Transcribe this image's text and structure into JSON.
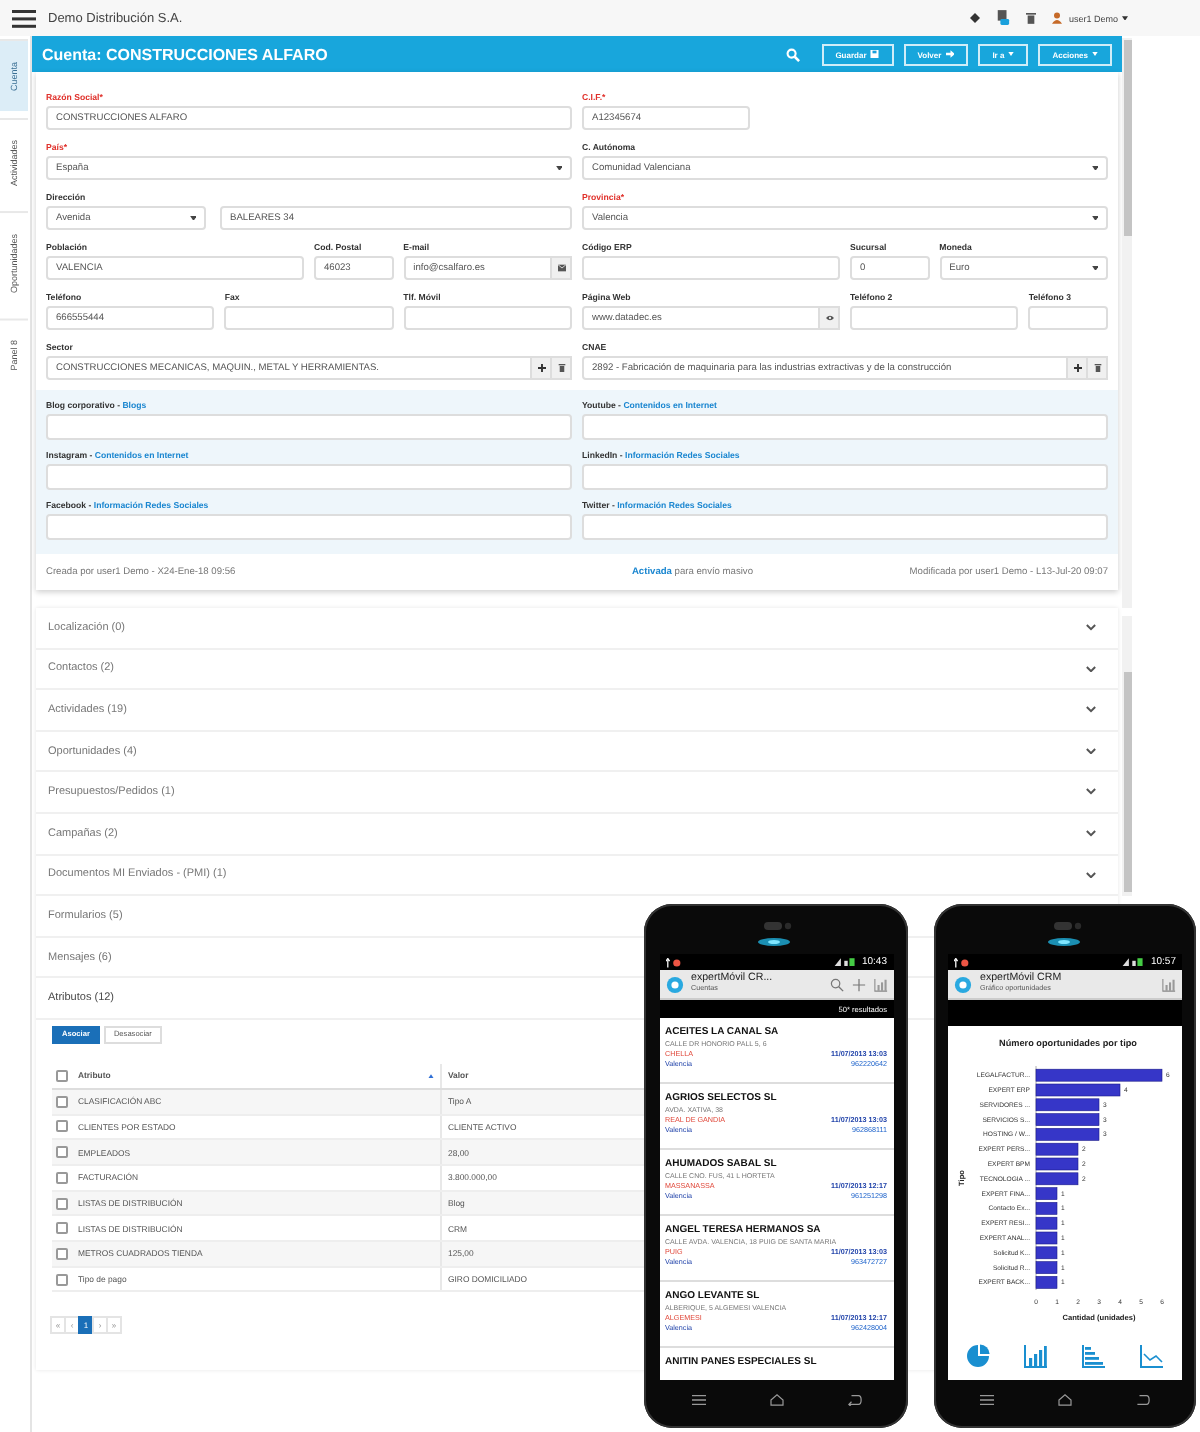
{
  "topbar": {
    "company": "Demo Distribución S.A.",
    "user": "user1 Demo"
  },
  "side_tabs": [
    {
      "label": "Cuenta",
      "selected": true
    },
    {
      "label": "Actividades",
      "selected": false
    },
    {
      "label": "Oportunidades",
      "selected": false
    },
    {
      "label": "Panel 8",
      "selected": false
    }
  ],
  "header": {
    "title": "Cuenta: CONSTRUCCIONES ALFARO",
    "buttons": [
      {
        "label": "Guardar",
        "kind": "save"
      },
      {
        "label": "Volver",
        "kind": "back"
      },
      {
        "label": "Ir a",
        "kind": "menu"
      },
      {
        "label": "Acciones",
        "kind": "menu"
      }
    ]
  },
  "form": {
    "rows": [
      [
        {
          "label": "Razón Social*",
          "required": true,
          "kind": "text",
          "value": "CONSTRUCCIONES ALFARO"
        },
        {
          "label": "C.I.F.*",
          "required": true,
          "kind": "text",
          "value": "A12345674"
        }
      ],
      [
        {
          "label": "País*",
          "required": true,
          "kind": "select",
          "value": "España"
        },
        {
          "label": "C. Autónoma",
          "required": false,
          "kind": "select",
          "value": "Comunidad Valenciana"
        }
      ],
      [
        {
          "label": "Dirección",
          "required": false,
          "kind": "address",
          "values": [
            "Avenida",
            "BALEARES 34"
          ]
        },
        {
          "label": "Provincia*",
          "required": true,
          "kind": "select",
          "value": "Valencia"
        }
      ],
      [
        {
          "label": "Población",
          "required": false,
          "kind": "text",
          "value": "VALENCIA"
        },
        {
          "label": "Cod. Postal",
          "required": false,
          "kind": "text",
          "value": "46023"
        },
        {
          "label": "E-mail",
          "required": false,
          "kind": "email",
          "value": "info@csalfaro.es"
        },
        {
          "label": "Código ERP",
          "required": false,
          "kind": "text"
        },
        {
          "label": "Sucursal",
          "required": false,
          "kind": "text",
          "value": "0"
        },
        {
          "label": "Moneda",
          "required": false,
          "kind": "select",
          "value": "Euro"
        }
      ],
      [
        {
          "label": "Teléfono",
          "required": false,
          "kind": "text",
          "value": "666555444"
        },
        {
          "label": "Fax",
          "required": false,
          "kind": "text"
        },
        {
          "label": "Tlf. Móvil",
          "required": false,
          "kind": "text"
        },
        {
          "label": "Página Web",
          "required": false,
          "kind": "web",
          "value": "www.datadec.es"
        },
        {
          "label": "Teléfono 2",
          "required": false,
          "kind": "text"
        },
        {
          "label": "Teléfono 3",
          "required": false,
          "kind": "text"
        }
      ],
      [
        {
          "label": "Sector",
          "required": false,
          "kind": "lookup",
          "value": "CONSTRUCCIONES MECANICAS, MAQUIN., METAL Y HERRAMIENTAS."
        },
        {
          "label": "CNAE",
          "required": false,
          "kind": "lookup",
          "value": "2892 - Fabricación de maquinaria para las industrias extractivas y de la construcción"
        }
      ]
    ]
  },
  "social": [
    {
      "label": "Blog corporativo -",
      "link": "Blogs"
    },
    {
      "label": "Youtube -",
      "link": "Contenidos en Internet"
    },
    {
      "label": "Instagram -",
      "link": "Contenidos en Internet"
    },
    {
      "label": "LinkedIn -",
      "link": "Información Redes Sociales"
    },
    {
      "label": "Facebook -",
      "link": "Información Redes Sociales"
    },
    {
      "label": "Twitter -",
      "link": "Información Redes Sociales"
    }
  ],
  "footer": {
    "created": "Creada por user1 Demo - X24-Ene-18 09:56",
    "mailing_link": "Activada",
    "mailing_text": "para envío masivo",
    "modified": "Modificada por user1 Demo - L13-Jul-20 09:07"
  },
  "sections": [
    {
      "label": "Localización (0)",
      "expanded": false,
      "toggle_visible": true
    },
    {
      "label": "Contactos (2)",
      "expanded": false,
      "toggle_visible": true
    },
    {
      "label": "Actividades (19)",
      "expanded": false,
      "toggle_visible": true
    },
    {
      "label": "Oportunidades (4)",
      "expanded": false,
      "toggle_visible": true
    },
    {
      "label": "Presupuestos/Pedidos (1)",
      "expanded": false,
      "toggle_visible": true
    },
    {
      "label": "Campañas (2)",
      "expanded": false,
      "toggle_visible": true
    },
    {
      "label": "Documentos MI Enviados - (PMI) (1)",
      "expanded": false,
      "toggle_visible": true
    },
    {
      "label": "Formularios (5)",
      "expanded": false,
      "toggle_visible": false
    },
    {
      "label": "Mensajes (6)",
      "expanded": false,
      "toggle_visible": false
    },
    {
      "label": "Atributos (12)",
      "expanded": true,
      "toggle_visible": false
    }
  ],
  "attributes": {
    "buttons": [
      {
        "label": "Asociar",
        "kind": "primary"
      },
      {
        "label": "Desasociar",
        "kind": "default"
      }
    ],
    "all_checked": false,
    "columns": [
      {
        "label": "Atributo",
        "sorted": true
      },
      {
        "label": "Valor",
        "sorted": false
      }
    ],
    "rows": [
      {
        "attribute": "CLASIFICACIÓN ABC",
        "value": "Tipo A",
        "checked": false
      },
      {
        "attribute": "CLIENTES POR ESTADO",
        "value": "CLIENTE ACTIVO",
        "checked": false
      },
      {
        "attribute": "EMPLEADOS",
        "value": "28,00",
        "checked": false
      },
      {
        "attribute": "FACTURACIÓN",
        "value": "3.800.000,00",
        "checked": false
      },
      {
        "attribute": "LISTAS DE DISTRIBUCIÓN",
        "value": "Blog",
        "checked": false
      },
      {
        "attribute": "LISTAS DE DISTRIBUCIÓN",
        "value": "CRM",
        "checked": false
      },
      {
        "attribute": "METROS CUADRADOS TIENDA",
        "value": "125,00",
        "checked": false
      },
      {
        "attribute": "Tipo de pago",
        "value": "GIRO DOMICILIADO",
        "checked": false
      }
    ],
    "pages": [
      {
        "label": "«",
        "selected": false
      },
      {
        "label": "‹",
        "selected": false
      },
      {
        "label": "1",
        "selected": true
      },
      {
        "label": "›",
        "selected": false
      },
      {
        "label": "»",
        "selected": false
      }
    ]
  },
  "mobile_list": {
    "time": "10:43",
    "app": "expertMóvil CR...",
    "subtitle": "Cuentas",
    "results": "50* resultados",
    "accounts": [
      {
        "name": "ACEITES LA CANAL SA",
        "address": "CALLE DR HONORIO PALL 5, 6",
        "town": "CHELLA",
        "date": "11/07/2013 13:03",
        "province": "Valencia",
        "phone": "962220642"
      },
      {
        "name": "AGRIOS SELECTOS SL",
        "address": "AVDA. XATIVA, 38",
        "town": "REAL DE GANDIA",
        "date": "11/07/2013 13:03",
        "province": "Valencia",
        "phone": "962868111"
      },
      {
        "name": "AHUMADOS SABAL SL",
        "address": "CALLE CNO. FUS, 41 L HORTETA",
        "town": "MASSANASSA",
        "date": "11/07/2013 12:17",
        "province": "Valencia",
        "phone": "961251298"
      },
      {
        "name": "ANGEL TERESA HERMANOS SA",
        "address": "CALLE AVDA. VALENCIA, 18 PUIG DE SANTA MARIA",
        "town": "PUIG",
        "date": "11/07/2013 13:03",
        "province": "Valencia",
        "phone": "963472727"
      },
      {
        "name": "ANGO LEVANTE SL",
        "address": "ALBERIQUE, 5 ALGEMESI VALENCIA",
        "town": "ALGEMESI",
        "date": "11/07/2013 12:17",
        "province": "Valencia",
        "phone": "962428004"
      },
      {
        "name": "ANITIN PANES ESPECIALES SL"
      }
    ]
  },
  "mobile_chart": {
    "time": "10:57",
    "app": "expertMóvil CRM",
    "subtitle": "Gráfico oportunidades",
    "chart_data": {
      "type": "bar",
      "orientation": "horizontal",
      "title": "Número oportunidades por tipo",
      "xlabel": "Cantidad (unidades)",
      "ylabel": "Tipo",
      "categories": [
        "LEGALFACTUR...",
        "EXPERT ERP",
        "SERVIDORES ...",
        "SERVICIOS S...",
        "HOSTING / W...",
        "EXPERT PERS...",
        "EXPERT BPM",
        "TECNOLOGIA ...",
        "EXPERT FINA...",
        "Contacto Ex...",
        "EXPERT RESI...",
        "EXPERT ANAL...",
        "Solicitud K...",
        "Solicitud R...",
        "EXPERT BACK..."
      ],
      "values": [
        6,
        4,
        3,
        3,
        3,
        2,
        2,
        2,
        1,
        1,
        1,
        1,
        1,
        1,
        1
      ],
      "xlim": [
        0,
        6
      ],
      "xticks": [
        0,
        1,
        2,
        3,
        4,
        5,
        6
      ],
      "data_labels": true
    }
  }
}
